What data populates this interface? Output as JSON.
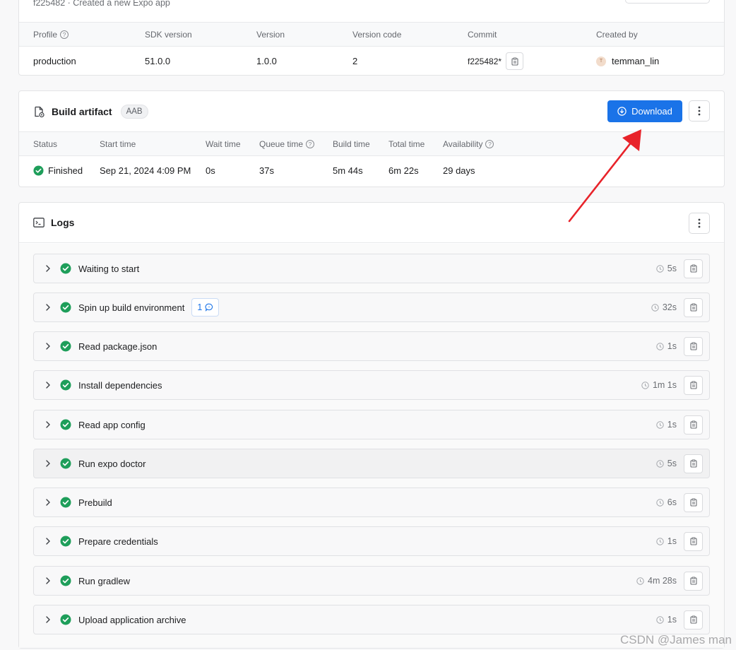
{
  "build": {
    "subtitle": "f225482 · Created a new Expo app",
    "headers": {
      "profile": "Profile",
      "sdk_version": "SDK version",
      "version": "Version",
      "version_code": "Version code",
      "commit": "Commit",
      "created_by": "Created by"
    },
    "values": {
      "profile": "production",
      "sdk_version": "51.0.0",
      "version": "1.0.0",
      "version_code": "2",
      "commit": "f225482*",
      "avatar_initial": "T",
      "created_by": "temman_lin"
    }
  },
  "artifact": {
    "title": "Build artifact",
    "badge": "AAB",
    "download_label": "Download",
    "headers": {
      "status": "Status",
      "start_time": "Start time",
      "wait_time": "Wait time",
      "queue_time": "Queue time",
      "build_time": "Build time",
      "total_time": "Total time",
      "availability": "Availability"
    },
    "values": {
      "status": "Finished",
      "start_time": "Sep 21, 2024 4:09 PM",
      "wait_time": "0s",
      "queue_time": "37s",
      "build_time": "5m 44s",
      "total_time": "6m 22s",
      "availability": "29 days"
    }
  },
  "logs": {
    "title": "Logs",
    "steps": [
      {
        "label": "Waiting to start",
        "duration": "5s"
      },
      {
        "label": "Spin up build environment",
        "duration": "32s",
        "warnings": "1"
      },
      {
        "label": "Read package.json",
        "duration": "1s"
      },
      {
        "label": "Install dependencies",
        "duration": "1m 1s"
      },
      {
        "label": "Read app config",
        "duration": "1s"
      },
      {
        "label": "Run expo doctor",
        "duration": "5s"
      },
      {
        "label": "Prebuild",
        "duration": "6s"
      },
      {
        "label": "Prepare credentials",
        "duration": "1s"
      },
      {
        "label": "Run gradlew",
        "duration": "4m 28s"
      },
      {
        "label": "Upload application archive",
        "duration": "1s"
      }
    ]
  },
  "colors": {
    "primary": "#1a73e8",
    "success": "#1e9e5a",
    "annotation_arrow": "#e8232a"
  },
  "watermark": "CSDN @James man"
}
